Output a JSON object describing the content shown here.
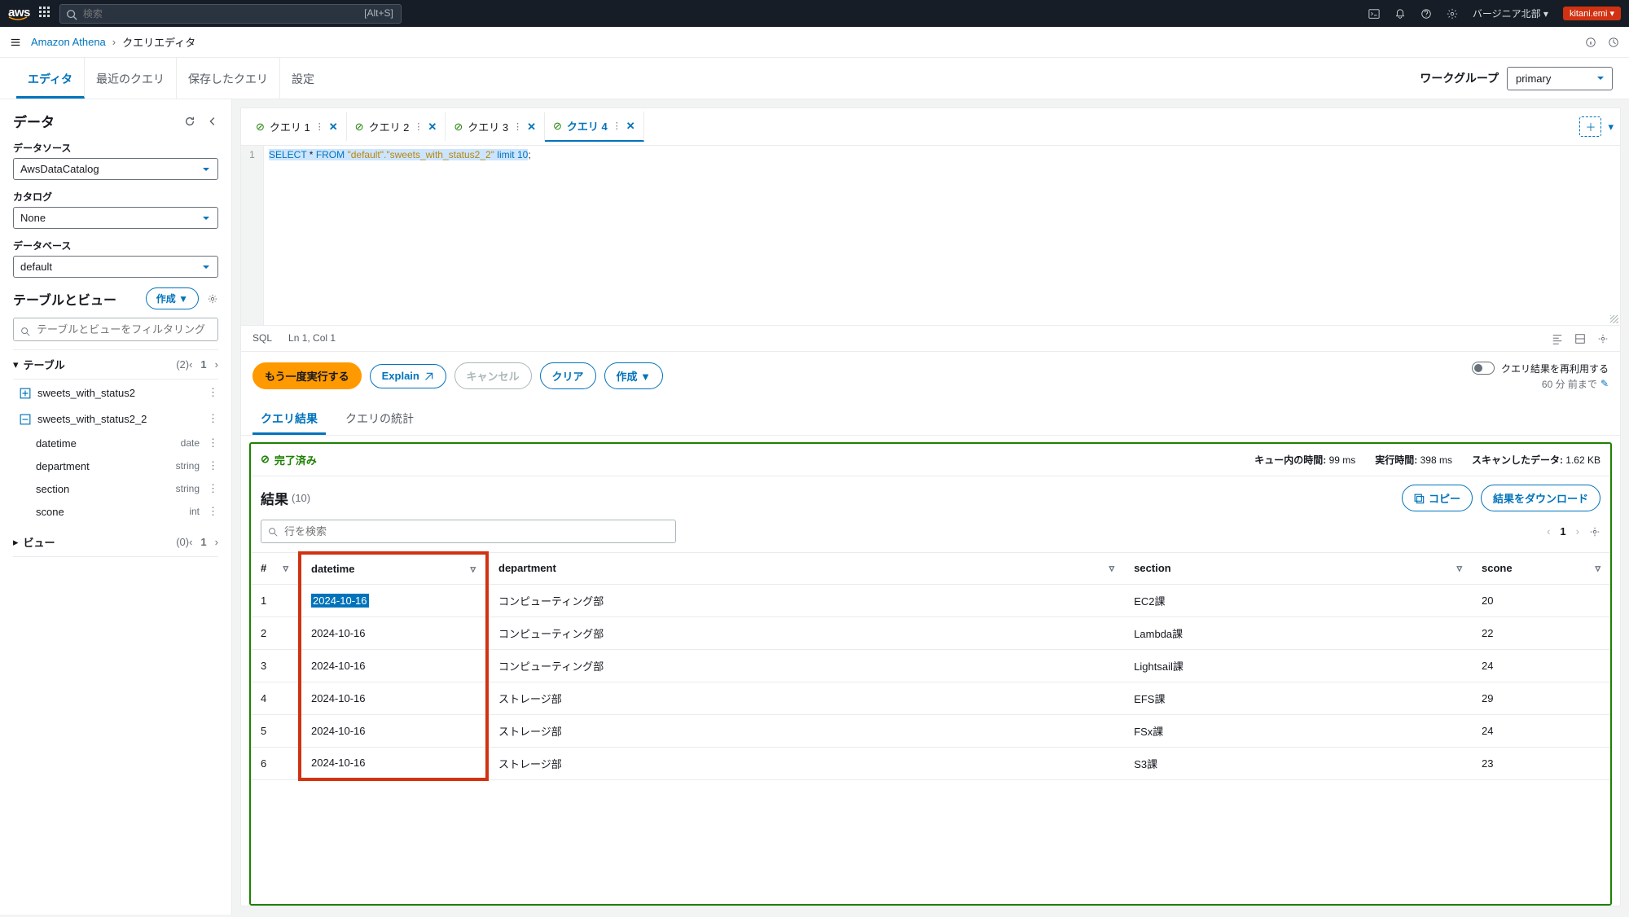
{
  "topbar": {
    "search_placeholder": "検索",
    "search_hint": "[Alt+S]",
    "region": "バージニア北部",
    "user": "kitani.emi"
  },
  "breadcrumb": {
    "service": "Amazon Athena",
    "page": "クエリエディタ"
  },
  "nav_tabs": {
    "editor": "エディタ",
    "recent": "最近のクエリ",
    "saved": "保存したクエリ",
    "settings": "設定",
    "workgroup_label": "ワークグループ",
    "workgroup_value": "primary"
  },
  "sidebar": {
    "title": "データ",
    "datasource_label": "データソース",
    "datasource_value": "AwsDataCatalog",
    "catalog_label": "カタログ",
    "catalog_value": "None",
    "database_label": "データベース",
    "database_value": "default",
    "tables_title": "テーブルとビュー",
    "create_btn": "作成 ▼",
    "filter_placeholder": "テーブルとビューをフィルタリング",
    "tables_section": "テーブル",
    "tables_count": "(2)",
    "tables_page": "1",
    "tables": [
      {
        "name": "sweets_with_status2",
        "expanded": false
      },
      {
        "name": "sweets_with_status2_2",
        "expanded": true,
        "columns": [
          {
            "name": "datetime",
            "type": "date"
          },
          {
            "name": "department",
            "type": "string"
          },
          {
            "name": "section",
            "type": "string"
          },
          {
            "name": "scone",
            "type": "int"
          }
        ]
      }
    ],
    "views_section": "ビュー",
    "views_count": "(0)",
    "views_page": "1"
  },
  "query_tabs": {
    "tabs": [
      {
        "name": "クエリ 1"
      },
      {
        "name": "クエリ 2"
      },
      {
        "name": "クエリ 3"
      },
      {
        "name": "クエリ 4",
        "active": true
      }
    ]
  },
  "editor": {
    "line_no": "1",
    "sql_kw1": "SELECT",
    "sql_star": " * ",
    "sql_kw2": "FROM",
    "sql_str": " \"default\".\"sweets_with_status2_2\" ",
    "sql_kw3": "limit",
    "sql_num": " 10",
    "sql_semi": ";",
    "status_lang": "SQL",
    "status_pos": "Ln 1, Col 1"
  },
  "actions": {
    "run": "もう一度実行する",
    "explain": "Explain",
    "cancel": "キャンセル",
    "clear": "クリア",
    "create": "作成 ▼",
    "reuse_label": "クエリ結果を再利用する",
    "reuse_age": "60 分 前まで"
  },
  "result_tabs": {
    "results": "クエリ結果",
    "stats": "クエリの統計"
  },
  "status": {
    "done": "完了済み",
    "queue_label": "キュー内の時間:",
    "queue_value": "99 ms",
    "run_label": "実行時間:",
    "run_value": "398 ms",
    "scan_label": "スキャンしたデータ:",
    "scan_value": "1.62 KB"
  },
  "results": {
    "title": "結果",
    "count": "(10)",
    "copy_btn": "コピー",
    "download_btn": "結果をダウンロード",
    "filter_placeholder": "行を検索",
    "page": "1",
    "columns": {
      "idx": "#",
      "datetime": "datetime",
      "department": "department",
      "section": "section",
      "scone": "scone"
    },
    "rows": [
      {
        "idx": "1",
        "datetime": "2024-10-16",
        "department": "コンピューティング部",
        "section": "EC2課",
        "scone": "20",
        "selected": true
      },
      {
        "idx": "2",
        "datetime": "2024-10-16",
        "department": "コンピューティング部",
        "section": "Lambda課",
        "scone": "22"
      },
      {
        "idx": "3",
        "datetime": "2024-10-16",
        "department": "コンピューティング部",
        "section": "Lightsail課",
        "scone": "24"
      },
      {
        "idx": "4",
        "datetime": "2024-10-16",
        "department": "ストレージ部",
        "section": "EFS課",
        "scone": "29"
      },
      {
        "idx": "5",
        "datetime": "2024-10-16",
        "department": "ストレージ部",
        "section": "FSx課",
        "scone": "24"
      },
      {
        "idx": "6",
        "datetime": "2024-10-16",
        "department": "ストレージ部",
        "section": "S3課",
        "scone": "23"
      }
    ]
  }
}
